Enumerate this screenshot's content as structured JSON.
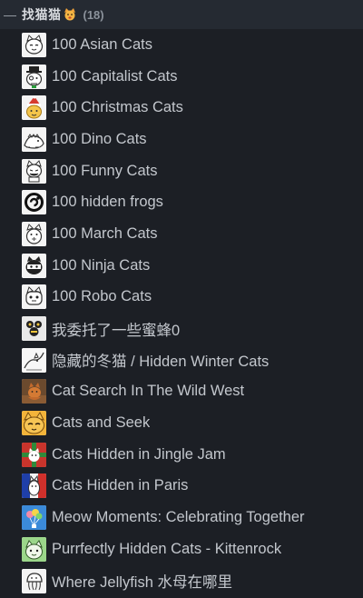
{
  "collection": {
    "collapse_symbol": "—",
    "title": "找猫猫",
    "emoji_icon": "cat-face-emoji",
    "count": "(18)"
  },
  "games": [
    {
      "name": "100 Asian Cats",
      "icon": "asian-cat-icon"
    },
    {
      "name": "100 Capitalist Cats",
      "icon": "capitalist-cat-icon"
    },
    {
      "name": "100 Christmas Cats",
      "icon": "christmas-cat-icon"
    },
    {
      "name": "100 Dino Cats",
      "icon": "dino-cat-icon"
    },
    {
      "name": "100 Funny Cats",
      "icon": "funny-cat-icon"
    },
    {
      "name": "100 hidden frogs",
      "icon": "frog-icon"
    },
    {
      "name": "100 March Cats",
      "icon": "march-cat-icon"
    },
    {
      "name": "100 Ninja Cats",
      "icon": "ninja-cat-icon"
    },
    {
      "name": "100 Robo Cats",
      "icon": "robo-cat-icon"
    },
    {
      "name": "我委托了一些蜜蜂0",
      "icon": "bee-icon"
    },
    {
      "name": "隐藏的冬猫 / Hidden Winter Cats",
      "icon": "winter-cat-icon"
    },
    {
      "name": "Cat Search In The Wild West",
      "icon": "wild-west-cat-icon"
    },
    {
      "name": "Cats and Seek",
      "icon": "cats-and-seek-icon"
    },
    {
      "name": "Cats Hidden in Jingle Jam",
      "icon": "jingle-jam-icon"
    },
    {
      "name": "Cats Hidden in Paris",
      "icon": "paris-cat-icon"
    },
    {
      "name": "Meow Moments: Celebrating Together",
      "icon": "meow-moments-icon"
    },
    {
      "name": "Purrfectly Hidden Cats - Kittenrock",
      "icon": "kittenrock-icon"
    },
    {
      "name": "Where Jellyfish 水母在哪里",
      "icon": "jellyfish-icon"
    }
  ]
}
